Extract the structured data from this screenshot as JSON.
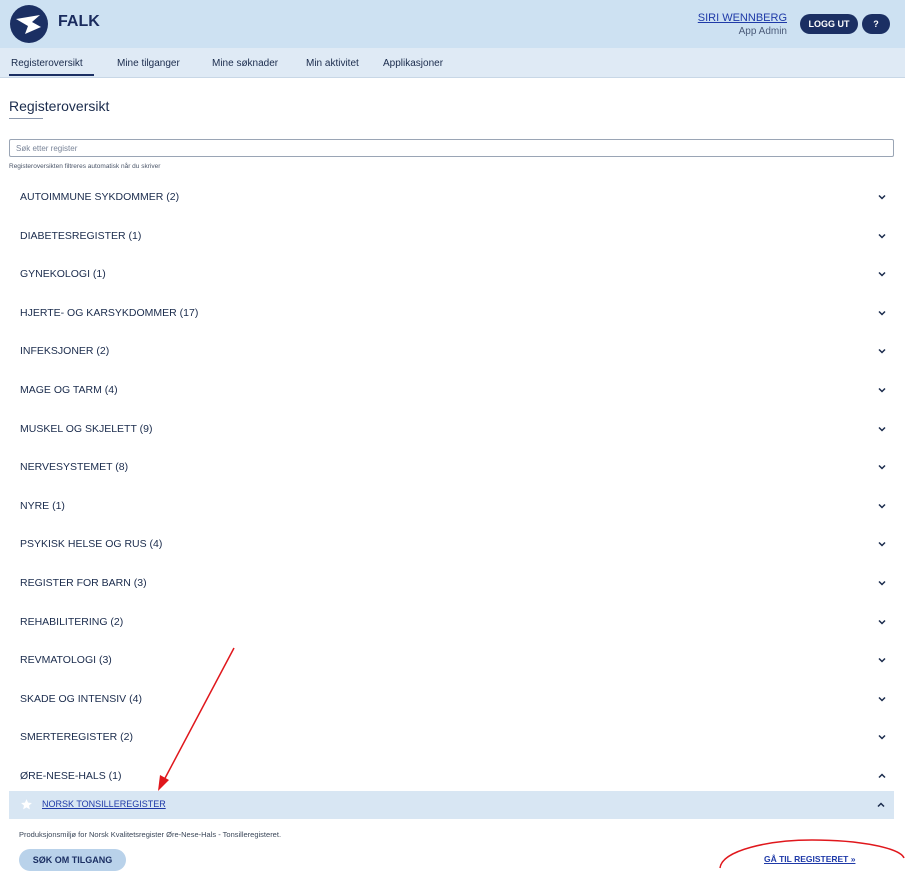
{
  "header": {
    "app_name": "FALK",
    "user_name": "SIRI WENNBERG",
    "user_role": "App Admin",
    "logout_label": "LOGG UT",
    "help_label": "?"
  },
  "nav": {
    "tabs": [
      {
        "label": "Registeroversikt",
        "active": true
      },
      {
        "label": "Mine tilganger",
        "active": false
      },
      {
        "label": "Mine søknader",
        "active": false
      },
      {
        "label": "Min aktivitet",
        "active": false
      },
      {
        "label": "Applikasjoner",
        "active": false
      }
    ]
  },
  "page": {
    "title": "Registeroversikt",
    "search_placeholder": "Søk etter register",
    "search_hint": "Registeroversikten filtreres automatisk når du skriver"
  },
  "categories": [
    {
      "label": "AUTOIMMUNE SYKDOMMER (2)",
      "expanded": false
    },
    {
      "label": "DIABETESREGISTER (1)",
      "expanded": false
    },
    {
      "label": "GYNEKOLOGI (1)",
      "expanded": false
    },
    {
      "label": "HJERTE- OG KARSYKDOMMER (17)",
      "expanded": false
    },
    {
      "label": "INFEKSJONER (2)",
      "expanded": false
    },
    {
      "label": "MAGE OG TARM (4)",
      "expanded": false
    },
    {
      "label": "MUSKEL OG SKJELETT (9)",
      "expanded": false
    },
    {
      "label": "NERVESYSTEMET (8)",
      "expanded": false
    },
    {
      "label": "NYRE (1)",
      "expanded": false
    },
    {
      "label": "PSYKISK HELSE OG RUS (4)",
      "expanded": false
    },
    {
      "label": "REGISTER FOR BARN (3)",
      "expanded": false
    },
    {
      "label": "REHABILITERING (2)",
      "expanded": false
    },
    {
      "label": "REVMATOLOGI (3)",
      "expanded": false
    },
    {
      "label": "SKADE OG INTENSIV (4)",
      "expanded": false
    },
    {
      "label": "SMERTEREGISTER (2)",
      "expanded": false
    },
    {
      "label": "ØRE-NESE-HALS (1)",
      "expanded": true
    }
  ],
  "register": {
    "name": "NORSK TONSILLEREGISTER",
    "description": "Produksjonsmiljø for Norsk Kvalitetsregister Øre-Nese-Hals - Tonsilleregisteret.",
    "apply_label": "SØK OM TILGANG",
    "goto_label": "GÅ TIL REGISTERET »"
  },
  "colors": {
    "header_bg": "#cde1f2",
    "nav_bg": "#dfeaf5",
    "primary_button": "#1b2f63",
    "link": "#1f3aa8",
    "annotation": "#e0171c"
  }
}
